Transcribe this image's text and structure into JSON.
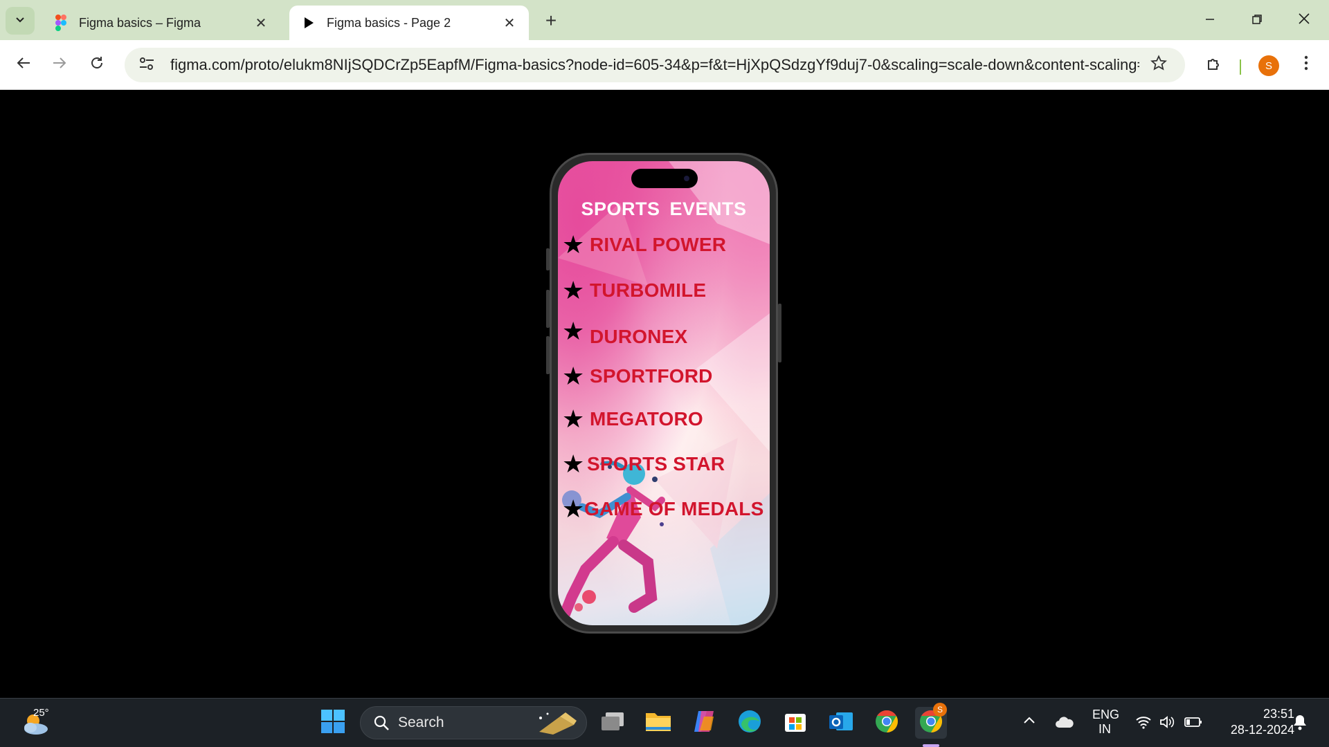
{
  "browser": {
    "tabs": [
      {
        "title": "Figma basics – Figma",
        "icon": "figma-logo-icon",
        "active": false
      },
      {
        "title": "Figma basics - Page 2",
        "icon": "play-icon",
        "active": true
      }
    ],
    "address_bar": {
      "url": "figma.com/proto/elukm8NIjSQDCrZp5EapfM/Figma-basics?node-id=605-34&p=f&t=HjXpQSdzgYf9duj7-0&scaling=scale-down&content-scaling=fix..."
    },
    "profile_initial": "S"
  },
  "prototype": {
    "title": "SPORTS  EVENTS",
    "events": [
      {
        "name": "RIVAL POWER"
      },
      {
        "name": "TURBOMILE"
      },
      {
        "name": "DURONEX"
      },
      {
        "name": "SPORTFORD"
      },
      {
        "name": "MEGATORO"
      },
      {
        "name": "SPORTS STAR"
      },
      {
        "name": "GAME OF MEDALS"
      }
    ],
    "colors": {
      "title": "#ffffff",
      "event_label": "#d2152d",
      "star": "#000000",
      "screen_top": "#ec6aa9"
    }
  },
  "taskbar": {
    "weather_temp": "25°",
    "search_placeholder": "Search",
    "chrome_badge": "S",
    "language_line1": "ENG",
    "language_line2": "IN",
    "time": "23:51",
    "date": "28-12-2024"
  }
}
